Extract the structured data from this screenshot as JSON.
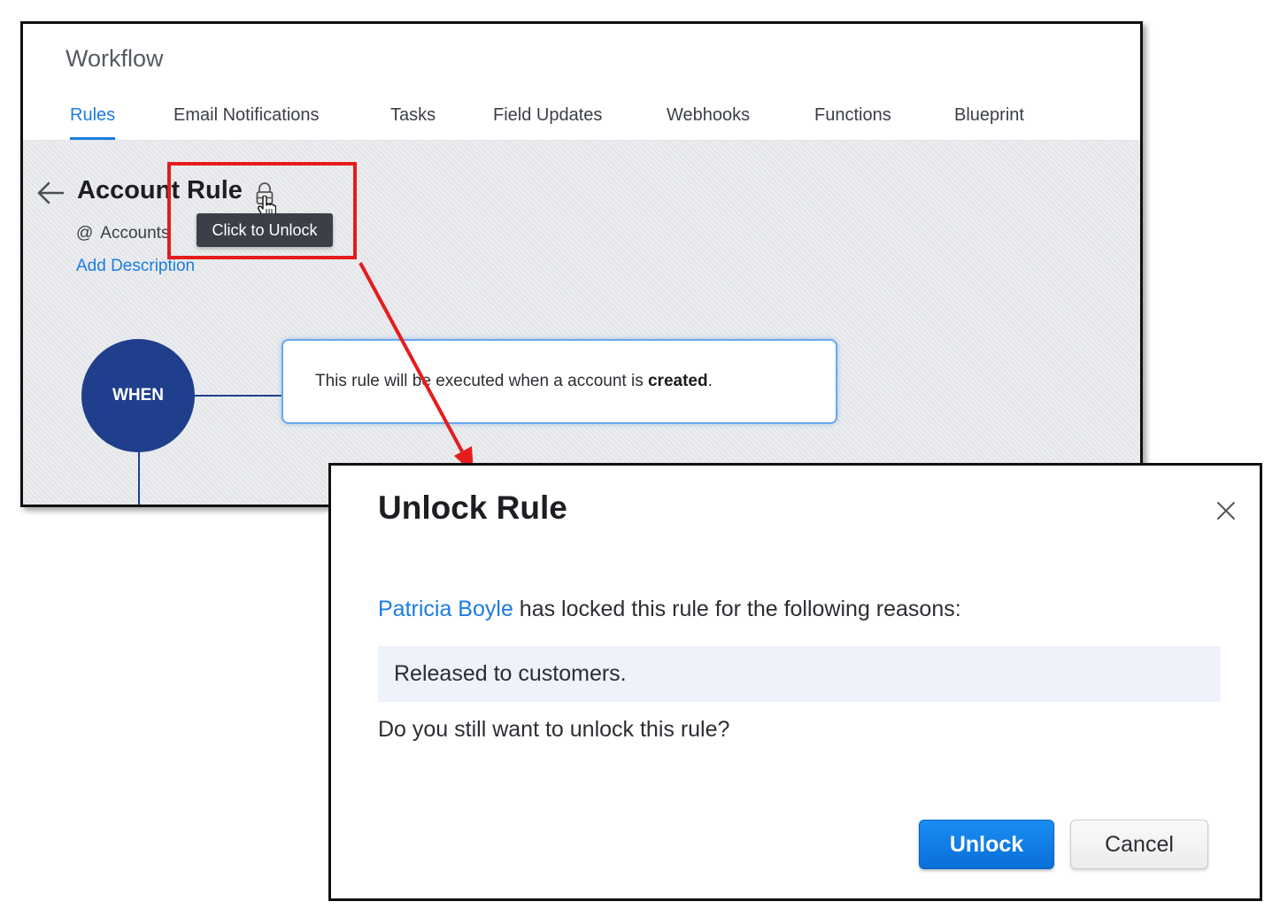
{
  "app": {
    "title": "Workflow"
  },
  "tabs": [
    "Rules",
    "Email Notifications",
    "Tasks",
    "Field Updates",
    "Webhooks",
    "Functions",
    "Blueprint"
  ],
  "rule": {
    "name": "Account Rule",
    "module_prefix": "@",
    "module": "Accounts",
    "add_description": "Add Description",
    "tooltip": "Click to Unlock"
  },
  "flow": {
    "when_label": "WHEN",
    "condition_prefix": "This rule will be executed when a account is ",
    "condition_event": "created",
    "condition_suffix": "."
  },
  "dialog": {
    "title": "Unlock Rule",
    "locked_by_user": "Patricia Boyle",
    "locked_by_text": " has locked this rule for the following reasons:",
    "reason": "Released to customers.",
    "confirm": "Do you still want to unlock this rule?",
    "unlock_label": "Unlock",
    "cancel_label": "Cancel"
  },
  "colors": {
    "accent": "#1c7ce0",
    "when_circle": "#1f3f8c",
    "annotation": "#e51c1c",
    "reason_bg": "#edf2fb"
  },
  "icons": {
    "back": "arrow-left-icon",
    "lock": "lock-icon",
    "cursor": "hand-cursor-icon",
    "close": "close-icon"
  }
}
